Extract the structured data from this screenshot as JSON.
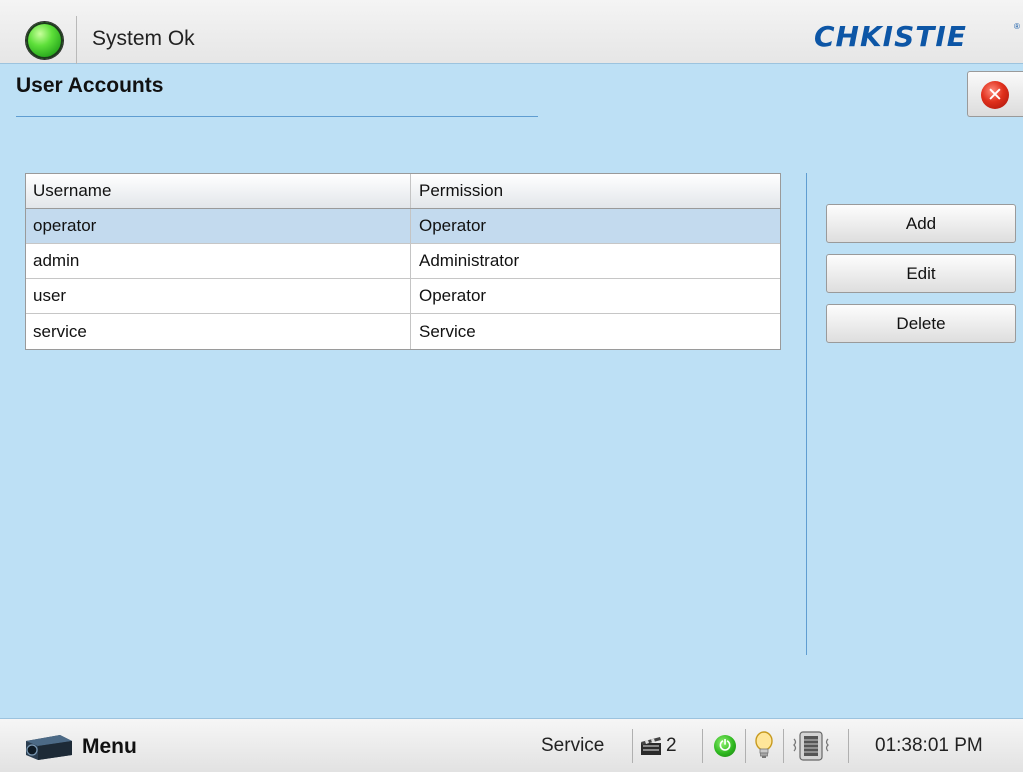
{
  "header": {
    "status_text": "System Ok",
    "brand": "CHKISTIE",
    "brand_mark": "®",
    "status_color": "#2eb81f"
  },
  "page": {
    "title": "User Accounts",
    "close_icon": "close-icon",
    "close_glyph": "✕"
  },
  "table": {
    "columns": [
      "Username",
      "Permission"
    ],
    "rows": [
      {
        "username": "operator",
        "permission": "Operator",
        "selected": true
      },
      {
        "username": "admin",
        "permission": "Administrator",
        "selected": false
      },
      {
        "username": "user",
        "permission": "Operator",
        "selected": false
      },
      {
        "username": "service",
        "permission": "Service",
        "selected": false
      }
    ],
    "selected_color": "#c3daee"
  },
  "actions": {
    "add_label": "Add",
    "edit_label": "Edit",
    "delete_label": "Delete"
  },
  "bottom_bar": {
    "menu_label": "Menu",
    "mode": "Service",
    "channel": "2",
    "power_glyph": "⏻",
    "time": "01:38:01 PM"
  },
  "colors": {
    "background": "#bde0f5",
    "accent_line": "#5f9dd1",
    "brand": "#0d56a6"
  }
}
